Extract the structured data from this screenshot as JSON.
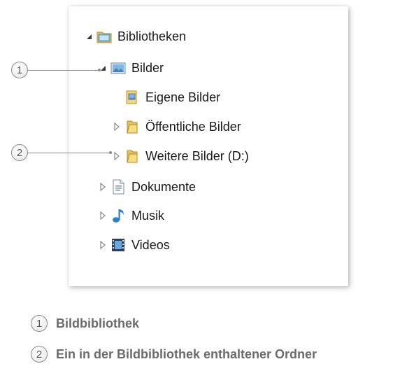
{
  "tree": {
    "items": [
      {
        "label": "Bibliotheken",
        "toggle": "expanded",
        "icon": "library-folder-icon"
      },
      {
        "label": "Bilder",
        "toggle": "expanded",
        "icon": "pictures-library-icon"
      },
      {
        "label": "Eigene Bilder",
        "toggle": "none",
        "icon": "my-pictures-folder-icon"
      },
      {
        "label": "Öffentliche Bilder",
        "toggle": "collapsed",
        "icon": "folder-icon"
      },
      {
        "label": "Weitere Bilder (D:)",
        "toggle": "collapsed",
        "icon": "folder-icon"
      },
      {
        "label": "Dokumente",
        "toggle": "collapsed",
        "icon": "documents-icon"
      },
      {
        "label": "Musik",
        "toggle": "collapsed",
        "icon": "music-note-icon"
      },
      {
        "label": "Videos",
        "toggle": "collapsed",
        "icon": "video-film-icon"
      }
    ]
  },
  "callouts": [
    {
      "number": "1",
      "text": "Bildbibliothek"
    },
    {
      "number": "2",
      "text": "Ein in der Bildbibliothek enthaltener Ordner"
    }
  ]
}
